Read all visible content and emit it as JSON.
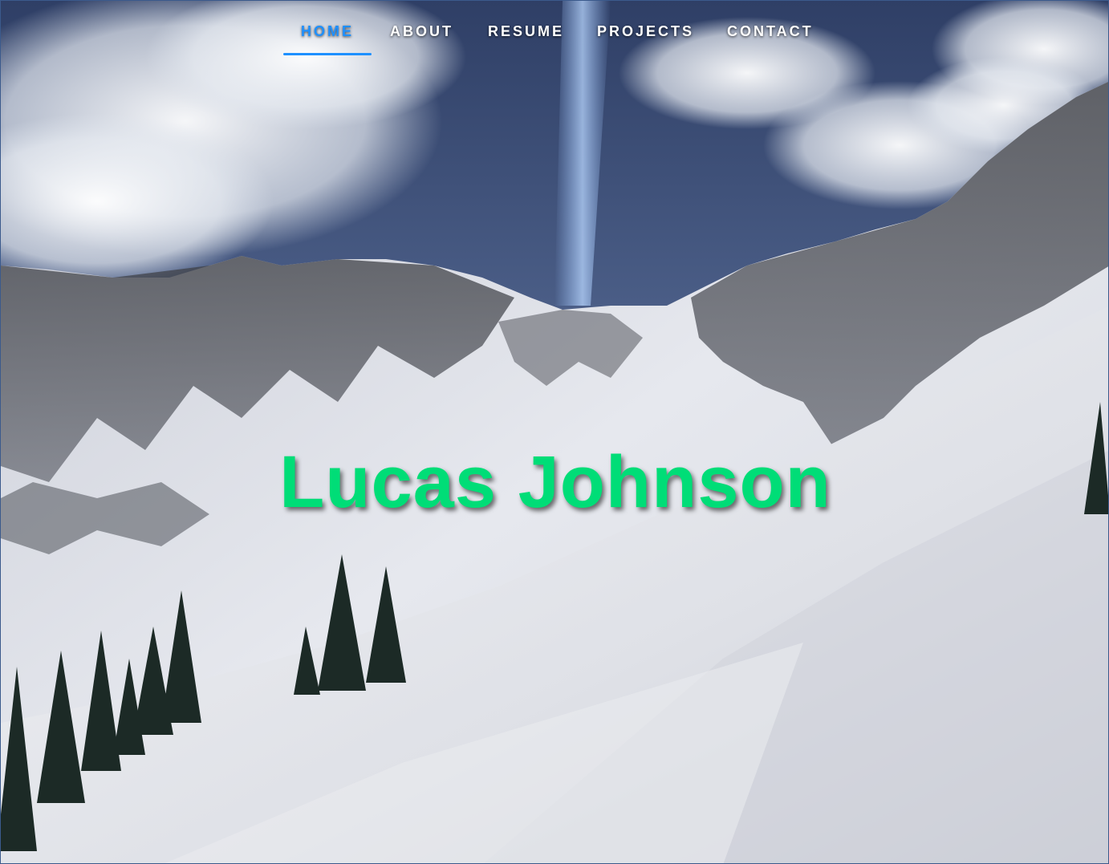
{
  "nav": {
    "items": [
      {
        "label": "HOME",
        "active": true
      },
      {
        "label": "ABOUT",
        "active": false
      },
      {
        "label": "RESUME",
        "active": false
      },
      {
        "label": "PROJECTS",
        "active": false
      },
      {
        "label": "CONTACT",
        "active": false
      }
    ]
  },
  "hero": {
    "name": "Lucas Johnson",
    "background_description_icon": "mountain-snow-photo"
  },
  "colors": {
    "accent": "#1e90ff",
    "name_color": "#00dd77",
    "nav_text": "#ffffff"
  }
}
